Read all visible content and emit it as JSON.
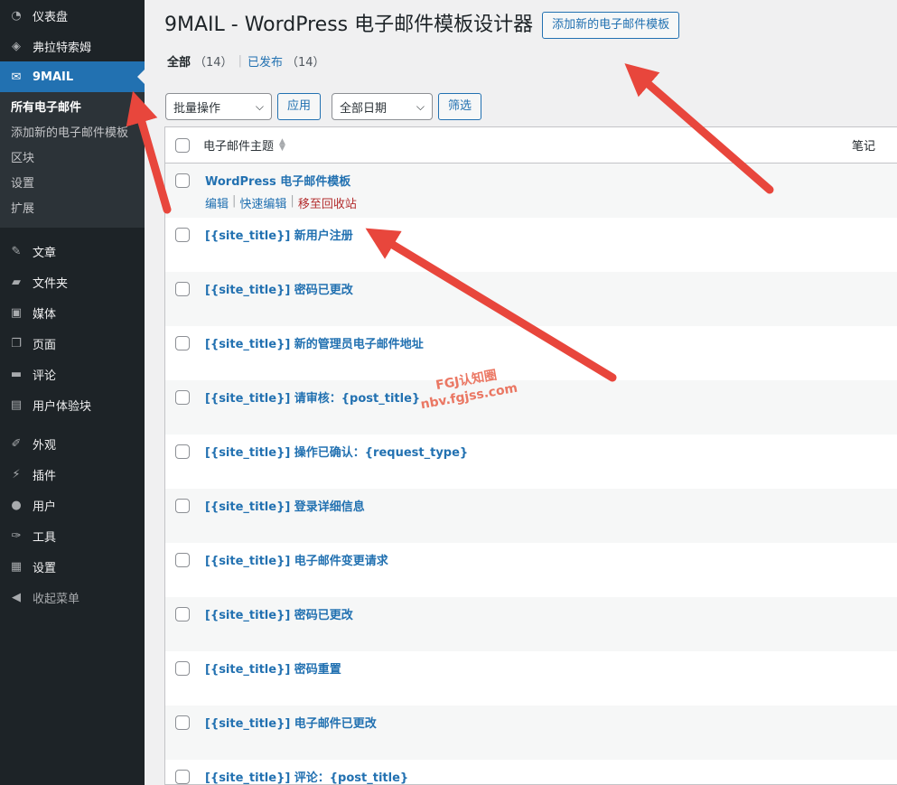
{
  "sidebar": {
    "items": [
      {
        "label": "仪表盘",
        "icon": "dashboard-icon",
        "glyph": "◔"
      },
      {
        "label": "弗拉特索姆",
        "icon": "diamond-icon",
        "glyph": "◈"
      },
      {
        "label": "9MAIL",
        "icon": "envelope-icon",
        "glyph": "✉"
      }
    ],
    "submenu": [
      {
        "label": "所有电子邮件"
      },
      {
        "label": "添加新的电子邮件模板"
      },
      {
        "label": "区块"
      },
      {
        "label": "设置"
      },
      {
        "label": "扩展"
      }
    ],
    "items2": [
      {
        "label": "文章",
        "icon": "pin-icon",
        "glyph": "✎"
      },
      {
        "label": "文件夹",
        "icon": "folder-icon",
        "glyph": "▰"
      },
      {
        "label": "媒体",
        "icon": "media-icon",
        "glyph": "▣"
      },
      {
        "label": "页面",
        "icon": "page-icon",
        "glyph": "❐"
      },
      {
        "label": "评论",
        "icon": "comment-icon",
        "glyph": "▬"
      },
      {
        "label": "用户体验块",
        "icon": "blocks-icon",
        "glyph": "▤"
      }
    ],
    "items3": [
      {
        "label": "外观",
        "icon": "brush-icon",
        "glyph": "✐"
      },
      {
        "label": "插件",
        "icon": "plugin-icon",
        "glyph": "⚡"
      },
      {
        "label": "用户",
        "icon": "user-icon",
        "glyph": "●"
      },
      {
        "label": "工具",
        "icon": "wrench-icon",
        "glyph": "✑"
      },
      {
        "label": "设置",
        "icon": "settings-icon",
        "glyph": "▦"
      }
    ],
    "collapse": {
      "label": "收起菜单",
      "glyph": "◀"
    }
  },
  "header": {
    "title": "9MAIL - WordPress 电子邮件模板设计器",
    "add_button": "添加新的电子邮件模板"
  },
  "filters": {
    "all_label": "全部",
    "all_count": "（14）",
    "published_label": "已发布",
    "published_count": "（14）",
    "sep": "|"
  },
  "tablenav": {
    "bulk_action": "批量操作",
    "apply": "应用",
    "all_dates": "全部日期",
    "filter": "筛选"
  },
  "table": {
    "col_subject": "电子邮件主题",
    "col_notes": "笔记",
    "row_actions": {
      "edit": "编辑",
      "quick_edit": "快速编辑",
      "trash": "移至回收站",
      "sep": "|"
    },
    "rows": [
      {
        "title": "WordPress 电子邮件模板"
      },
      {
        "title": "[{site_title}] 新用户注册"
      },
      {
        "title": "[{site_title}] 密码已更改"
      },
      {
        "title": "[{site_title}] 新的管理员电子邮件地址"
      },
      {
        "title": "[{site_title}] 请审核：{post_title}"
      },
      {
        "title": "[{site_title}] 操作已确认：{request_type}"
      },
      {
        "title": "[{site_title}] 登录详细信息"
      },
      {
        "title": "[{site_title}] 电子邮件变更请求"
      },
      {
        "title": "[{site_title}] 密码已更改"
      },
      {
        "title": "[{site_title}] 密码重置"
      },
      {
        "title": "[{site_title}] 电子邮件已更改"
      },
      {
        "title": "[{site_title}] 评论：{post_title}"
      }
    ]
  },
  "watermark": {
    "line1": "FGJ认知圈",
    "line2": "nbv.fgjss.com"
  },
  "colors": {
    "sidebar_bg": "#1d2327",
    "active": "#2271b1",
    "arrow": "#e8463c",
    "link": "#2271b1",
    "trash": "#b32d2e"
  }
}
